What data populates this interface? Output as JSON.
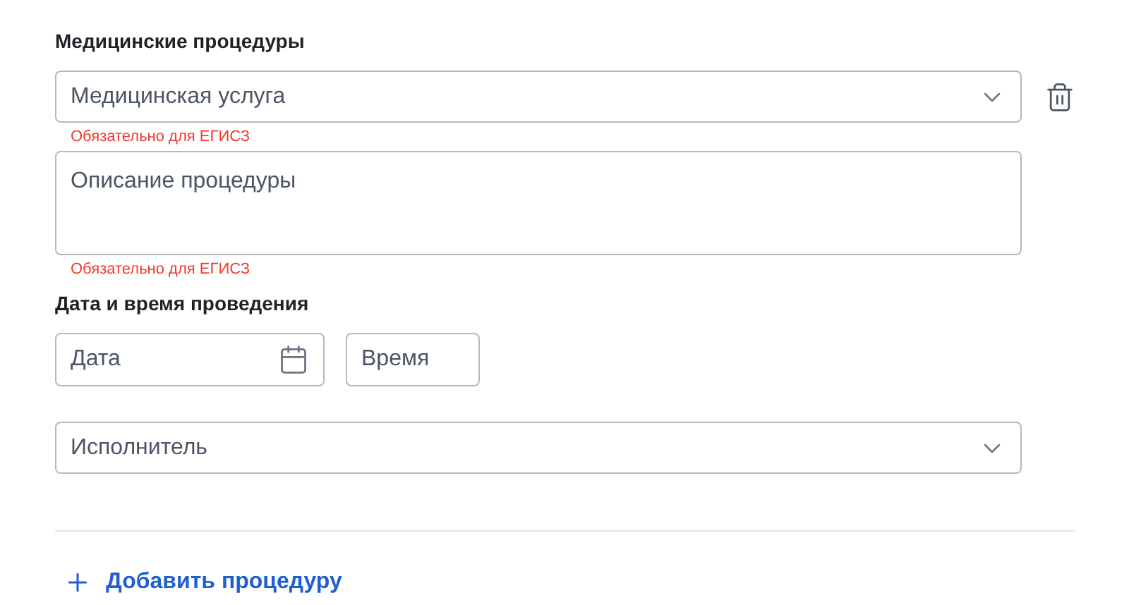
{
  "section_title": "Медицинские процедуры",
  "service_select": {
    "placeholder": "Медицинская услуга",
    "error": "Обязательно для ЕГИСЗ"
  },
  "description_field": {
    "placeholder": "Описание процедуры",
    "error": "Обязательно для ЕГИСЗ"
  },
  "datetime": {
    "label": "Дата и время проведения",
    "date_placeholder": "Дата",
    "time_placeholder": "Время"
  },
  "performer_select": {
    "placeholder": "Исполнитель"
  },
  "add_button": {
    "label": "Добавить процедуру"
  }
}
